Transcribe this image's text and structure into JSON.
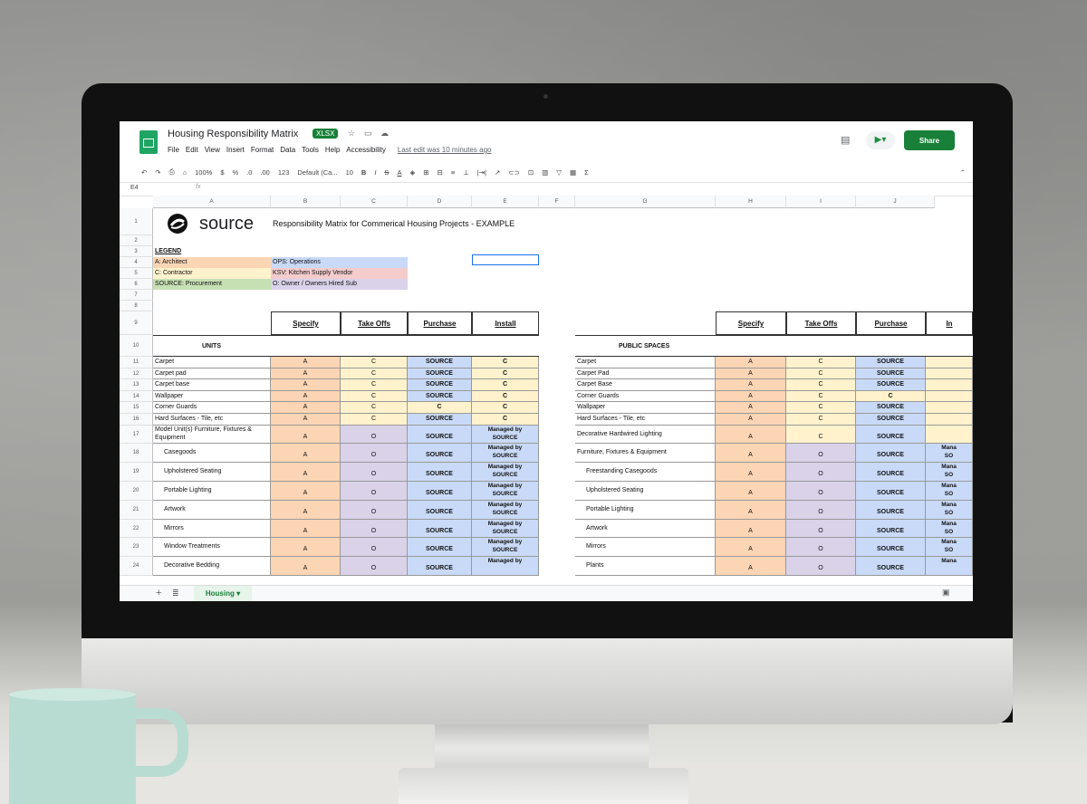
{
  "app": {
    "title": "Housing Responsibility Matrix",
    "badge": "XLSX",
    "menu": [
      "File",
      "Edit",
      "View",
      "Insert",
      "Format",
      "Data",
      "Tools",
      "Help",
      "Accessibility"
    ],
    "last_edit": "Last edit was 10 minutes ago",
    "share_label": "Share",
    "zoom": "100%",
    "font": "Default (Ca...",
    "font_size": "10",
    "number_format": "123",
    "currency": "$",
    "percent": "%",
    "dec_less": ".0",
    "dec_more": ".00",
    "name_box": "E4",
    "fx": "fx",
    "sheet_tab": "Housing",
    "colors": {
      "share": "#188038",
      "orange": "#fcd5b4",
      "yellow": "#fff2cc",
      "blue": "#c9daf8",
      "purple": "#d9d2e9",
      "green": "#c6e0b4",
      "pink": "#f4cccc"
    }
  },
  "columns": [
    "A",
    "B",
    "C",
    "D",
    "E",
    "F",
    "G",
    "H",
    "I",
    "J"
  ],
  "rows": [
    "1",
    "2",
    "3",
    "4",
    "5",
    "6",
    "7",
    "8",
    "9",
    "10",
    "11",
    "12",
    "13",
    "14",
    "15",
    "16",
    "17",
    "18",
    "19",
    "20",
    "21",
    "22",
    "23",
    "24"
  ],
  "sheet": {
    "logo": "source",
    "heading": "Responsibility Matrix for Commerical Housing Projects - EXAMPLE",
    "legend_title": "LEGEND",
    "legend": [
      "A: Architect",
      "OPS: Operations",
      "C:  Contractor",
      "KSV: Kitchen Supply Vendor",
      "SOURCE: Procurement",
      "O: Owner / Owners Hired Sub"
    ],
    "headers": [
      "Specify",
      "Take Offs",
      "Purchase",
      "Install"
    ],
    "right_headers": [
      "Specify",
      "Take Offs",
      "Purchase",
      "In"
    ],
    "left_section": "UNITS",
    "right_section": "PUBLIC SPACES",
    "left_rows": [
      {
        "label": "Carpet",
        "v": [
          "A",
          "C",
          "SOURCE",
          "C"
        ]
      },
      {
        "label": "Carpet pad",
        "v": [
          "A",
          "C",
          "SOURCE",
          "C"
        ]
      },
      {
        "label": "Carpet base",
        "v": [
          "A",
          "C",
          "SOURCE",
          "C"
        ]
      },
      {
        "label": "Wallpaper",
        "v": [
          "A",
          "C",
          "SOURCE",
          "C"
        ]
      },
      {
        "label": "Corner Guards",
        "v": [
          "A",
          "C",
          "C",
          "C"
        ]
      },
      {
        "label": "Hard Surfaces - Tile, etc",
        "v": [
          "A",
          "C",
          "SOURCE",
          "C"
        ]
      },
      {
        "label": "Model Unit(s) Furniture, Fixtures &",
        "label2": "Equipment",
        "v": [
          "A",
          "O",
          "SOURCE",
          "Managed by"
        ],
        "v2": "SOURCE"
      },
      {
        "label": "Casegoods",
        "v": [
          "A",
          "O",
          "SOURCE",
          "Managed by"
        ],
        "v2": "SOURCE"
      },
      {
        "label": "Upholstered Seating",
        "v": [
          "A",
          "O",
          "SOURCE",
          "Managed by"
        ],
        "v2": "SOURCE"
      },
      {
        "label": "Portable Lighting",
        "v": [
          "A",
          "O",
          "SOURCE",
          "Managed by"
        ],
        "v2": "SOURCE"
      },
      {
        "label": "Artwork",
        "v": [
          "A",
          "O",
          "SOURCE",
          "Managed by"
        ],
        "v2": "SOURCE"
      },
      {
        "label": "Mirrors",
        "v": [
          "A",
          "O",
          "SOURCE",
          "Managed by"
        ],
        "v2": "SOURCE"
      },
      {
        "label": "Window Treatments",
        "v": [
          "A",
          "O",
          "SOURCE",
          "Managed by"
        ],
        "v2": "SOURCE"
      },
      {
        "label": "Decorative Bedding",
        "v": [
          "A",
          "O",
          "SOURCE",
          "Managed by"
        ],
        "v2": ""
      }
    ],
    "right_rows": [
      {
        "label": "Carpet",
        "v": [
          "A",
          "C",
          "SOURCE",
          ""
        ]
      },
      {
        "label": "Carpet Pad",
        "v": [
          "A",
          "C",
          "SOURCE",
          ""
        ]
      },
      {
        "label": "Carpet Base",
        "v": [
          "A",
          "C",
          "SOURCE",
          ""
        ]
      },
      {
        "label": "Corner Guards",
        "v": [
          "A",
          "C",
          "C",
          ""
        ]
      },
      {
        "label": "Wallpaper",
        "v": [
          "A",
          "C",
          "SOURCE",
          ""
        ]
      },
      {
        "label": "Hard Surfaces - Tile, etc",
        "v": [
          "A",
          "C",
          "SOURCE",
          ""
        ]
      },
      {
        "label": "Decorative Hardwired Lighting",
        "v": [
          "A",
          "C",
          "SOURCE",
          ""
        ]
      },
      {
        "label": "Furniture, Fixtures & Equipment",
        "v": [
          "A",
          "O",
          "SOURCE",
          "Mana"
        ],
        "v2": "SO"
      },
      {
        "label": "Freestanding Casegoods",
        "v": [
          "A",
          "O",
          "SOURCE",
          "Mana"
        ],
        "v2": "SO"
      },
      {
        "label": "Upholstered Seating",
        "v": [
          "A",
          "O",
          "SOURCE",
          "Mana"
        ],
        "v2": "SO"
      },
      {
        "label": "Portable Lighting",
        "v": [
          "A",
          "O",
          "SOURCE",
          "Mana"
        ],
        "v2": "SO"
      },
      {
        "label": "Artwork",
        "v": [
          "A",
          "O",
          "SOURCE",
          "Mana"
        ],
        "v2": "SO"
      },
      {
        "label": "Mirrors",
        "v": [
          "A",
          "O",
          "SOURCE",
          "Mana"
        ],
        "v2": "SO"
      },
      {
        "label": "Plants",
        "v": [
          "A",
          "O",
          "SOURCE",
          "Mana"
        ],
        "v2": ""
      }
    ]
  }
}
